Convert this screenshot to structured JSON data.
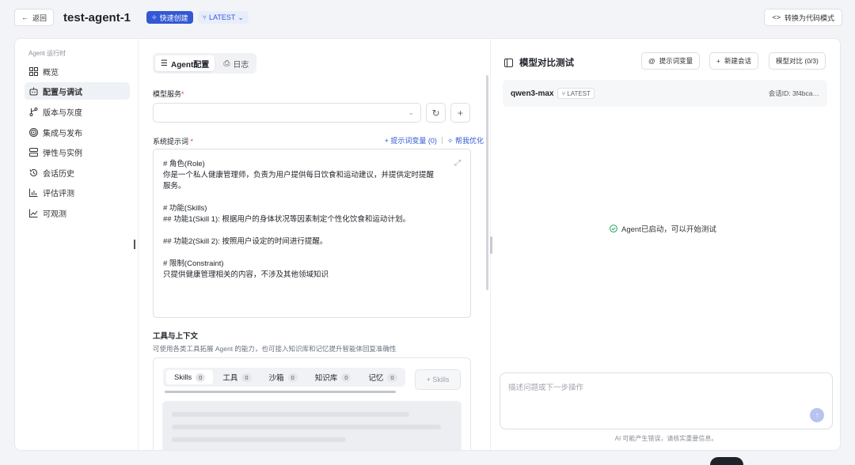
{
  "header": {
    "back_label": "返回",
    "agent_name": "test-agent-1",
    "quick_badge": "快速创建",
    "version_badge": "LATEST",
    "code_mode_label": "转换为代码模式"
  },
  "sidebar": {
    "heading": "Agent 运行时",
    "items": [
      {
        "label": "概览",
        "icon": "grid-icon"
      },
      {
        "label": "配置与调试",
        "icon": "robot-icon",
        "active": true
      },
      {
        "label": "版本与灰度",
        "icon": "branch-icon"
      },
      {
        "label": "集成与发布",
        "icon": "target-icon"
      },
      {
        "label": "弹性与实例",
        "icon": "server-icon"
      },
      {
        "label": "会话历史",
        "icon": "history-icon"
      },
      {
        "label": "评估评测",
        "icon": "bar-chart-icon"
      },
      {
        "label": "可观测",
        "icon": "line-chart-icon"
      }
    ]
  },
  "config": {
    "tabs": [
      {
        "label": "Agent配置",
        "icon": "sliders-icon",
        "active": true
      },
      {
        "label": "日志",
        "icon": "log-icon"
      }
    ],
    "model_service_label": "模型服务",
    "system_prompt_label": "系统提示词",
    "prompt_var_link": "+ 提示词变量 (0)",
    "optimize_link": "帮我优化",
    "prompt_lines": [
      "# 角色(Role)",
      "你是一个私人健康管理师，负责为用户提供每日饮食和运动建议，并提供定时提醒",
      "服务。",
      "",
      "# 功能(Skills)",
      "## 功能1(Skill 1): 根据用户的身体状况等因素制定个性化饮食和运动计划。",
      "",
      "## 功能2(Skill 2): 按照用户设定的时间进行提醒。",
      "",
      "# 限制(Constraint)",
      "只提供健康管理相关的内容，不涉及其他领域知识"
    ],
    "tools_title": "工具与上下文",
    "tools_desc": "可使用各类工具拓展 Agent 的能力，也可接入知识库和记忆提升智能体回复准确性",
    "tool_tabs": [
      {
        "label": "Skills",
        "count": "0",
        "active": true
      },
      {
        "label": "工具",
        "count": "0"
      },
      {
        "label": "沙箱",
        "count": "0"
      },
      {
        "label": "知识库",
        "count": "0"
      },
      {
        "label": "记忆",
        "count": "0"
      }
    ],
    "add_skills_label": "+ Skills"
  },
  "test_panel": {
    "title": "模型对比测试",
    "prompt_var_btn": "提示词变量",
    "new_session_btn": "新建会话",
    "compare_btn": "模型对比 (0/3)",
    "model_name": "qwen3-max",
    "model_version": "LATEST",
    "session_id": "会话ID: 3f4bca…",
    "ready_message": "Agent已启动，可以开始测试",
    "input_placeholder": "描述问题或下一步操作",
    "disclaimer": "AI 可能产生错误，请核实重要信息。"
  }
}
